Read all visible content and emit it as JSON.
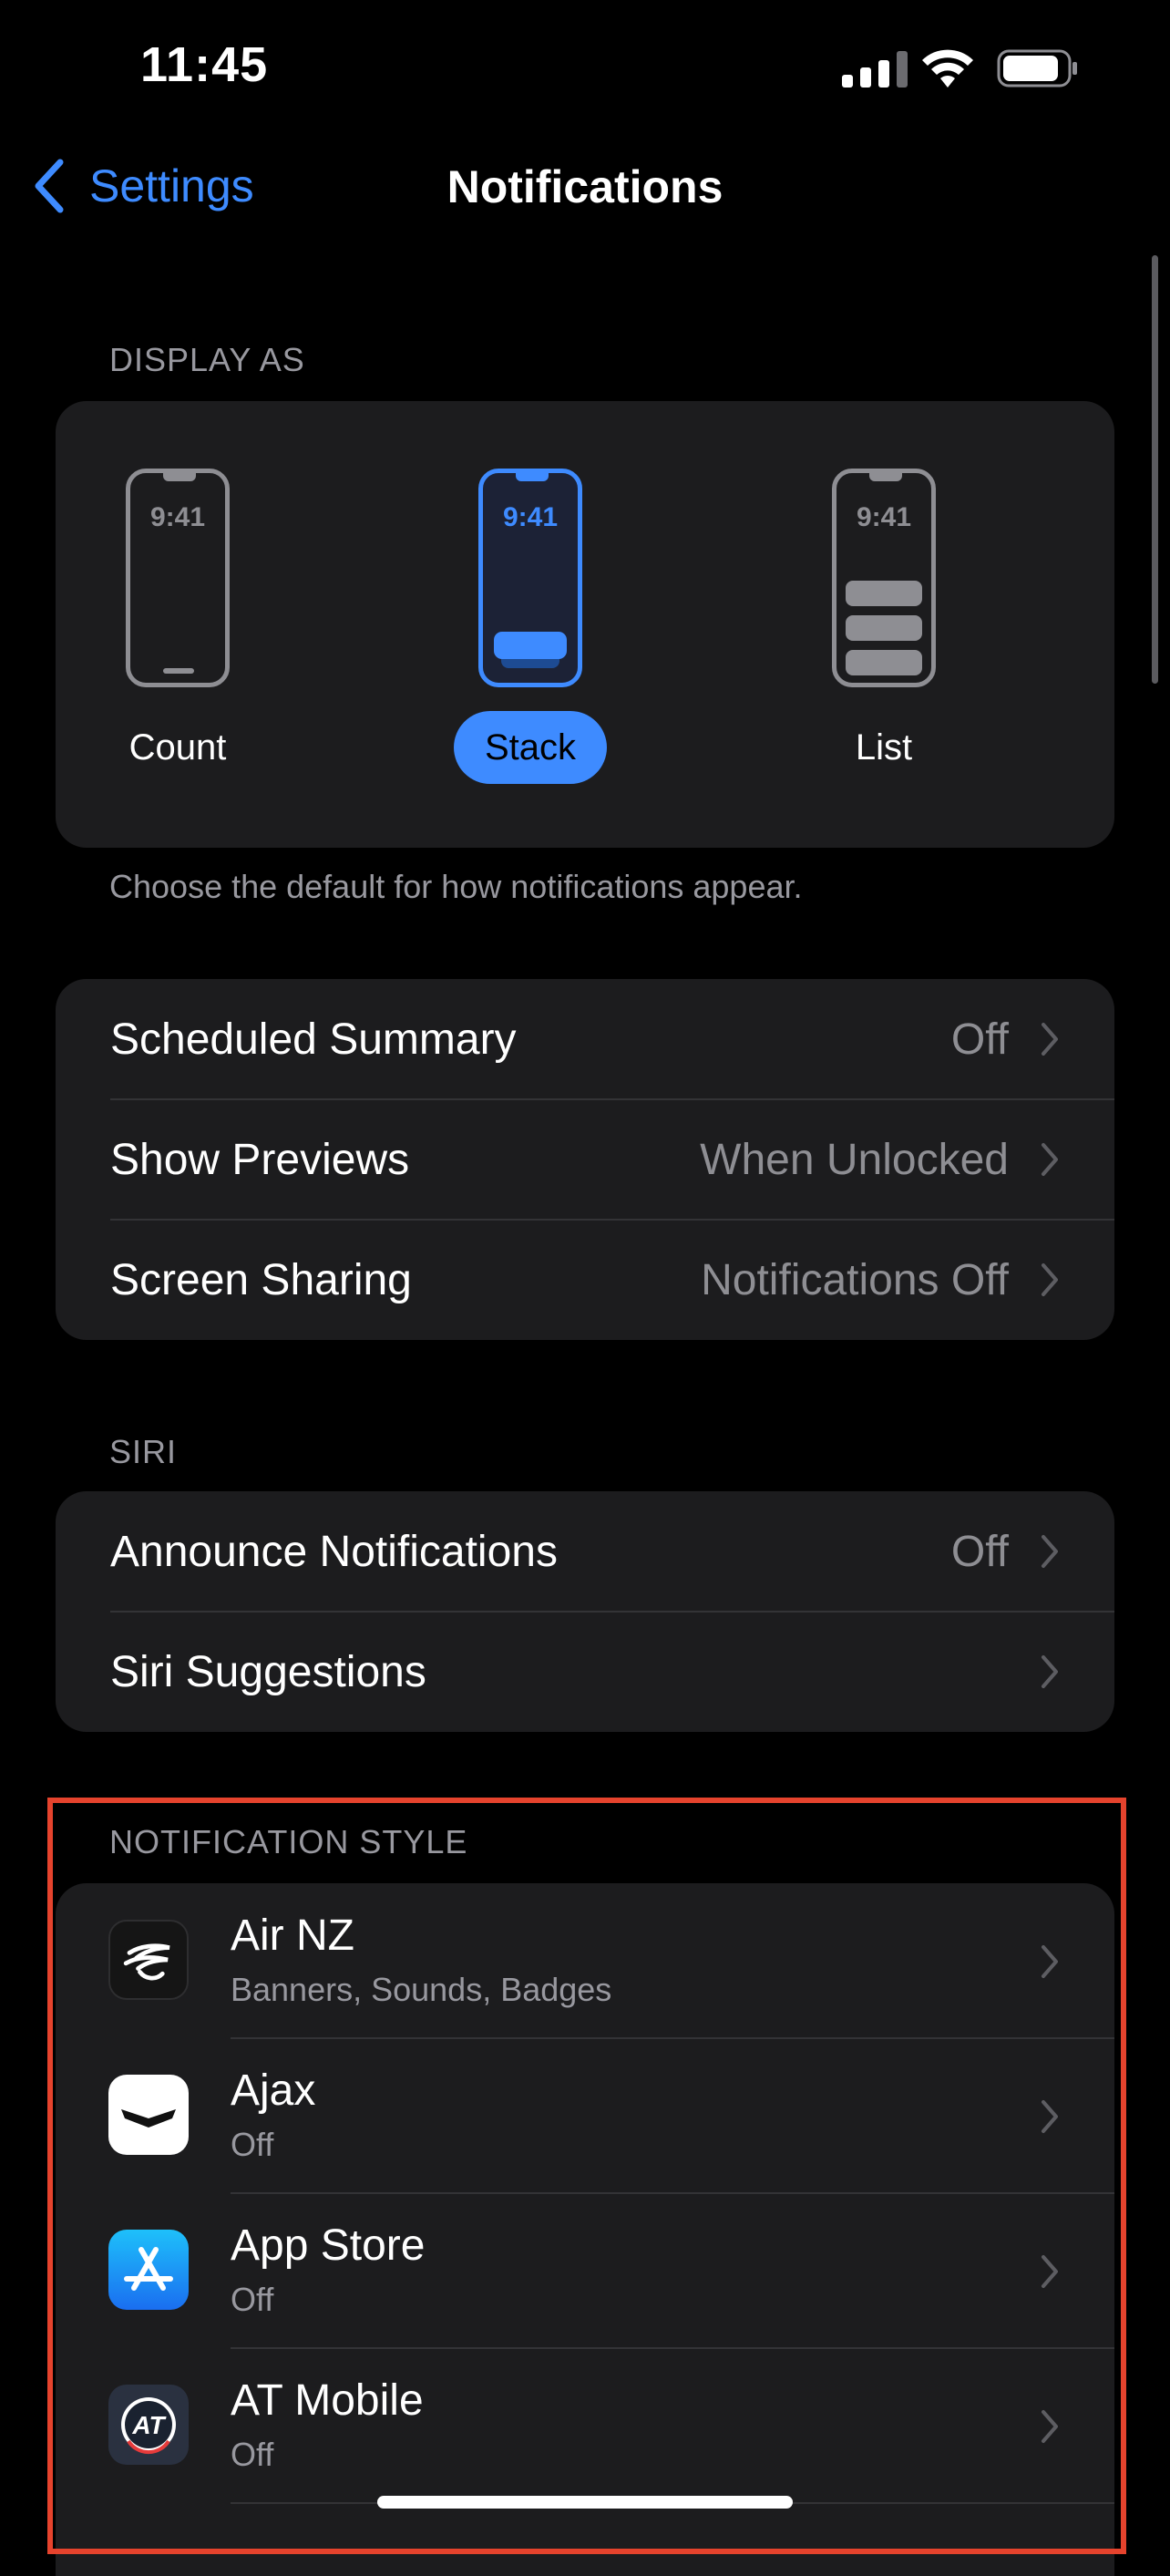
{
  "status_bar": {
    "time": "11:45"
  },
  "nav": {
    "back_label": "Settings",
    "title": "Notifications"
  },
  "display_as": {
    "header": "DISPLAY AS",
    "preview_time": "9:41",
    "options": [
      {
        "label": "Count",
        "selected": false
      },
      {
        "label": "Stack",
        "selected": true
      },
      {
        "label": "List",
        "selected": false
      }
    ],
    "footnote": "Choose the default for how notifications appear."
  },
  "settings_group": [
    {
      "label": "Scheduled Summary",
      "value": "Off"
    },
    {
      "label": "Show Previews",
      "value": "When Unlocked"
    },
    {
      "label": "Screen Sharing",
      "value": "Notifications Off"
    }
  ],
  "siri": {
    "header": "SIRI",
    "rows": [
      {
        "label": "Announce Notifications",
        "value": "Off"
      },
      {
        "label": "Siri Suggestions",
        "value": ""
      }
    ]
  },
  "notification_style": {
    "header": "NOTIFICATION STYLE",
    "apps": [
      {
        "name": "Air NZ",
        "detail": "Banners, Sounds, Badges",
        "icon": "air-nz-icon"
      },
      {
        "name": "Ajax",
        "detail": "Off",
        "icon": "ajax-icon"
      },
      {
        "name": "App Store",
        "detail": "Off",
        "icon": "app-store-icon"
      },
      {
        "name": "AT Mobile",
        "detail": "Off",
        "icon": "at-mobile-icon"
      }
    ]
  },
  "colors": {
    "accent": "#3e8bff",
    "highlight_border": "#e5432d",
    "card_bg": "#1c1c1e"
  }
}
